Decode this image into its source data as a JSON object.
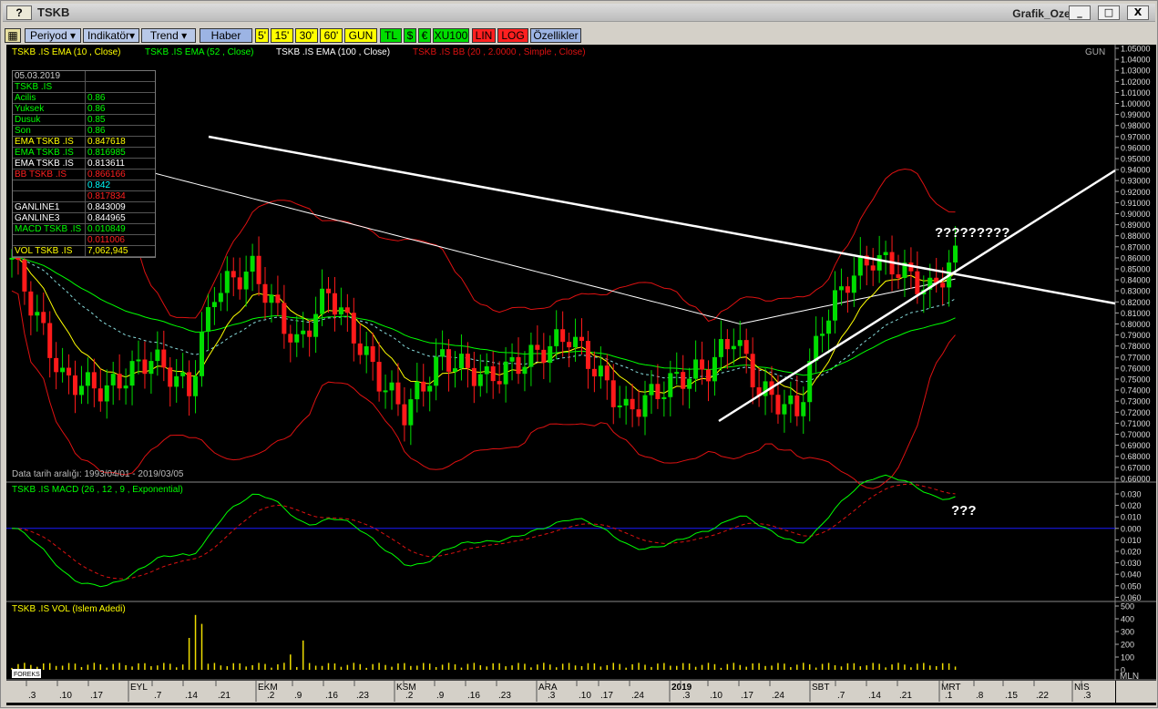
{
  "window": {
    "help_label": "?",
    "title": "TSKB",
    "right_title": "Grafik_Ozel",
    "minimize": "_",
    "maximize": "□",
    "close": "X"
  },
  "toolbar": {
    "period": "Periyod",
    "indicator": "Indikatör",
    "trend": "Trend",
    "news": "Haber",
    "intervals": [
      "5'",
      "15'",
      "30'",
      "60'",
      "GUN"
    ],
    "currency": [
      "TL",
      "$",
      "€",
      "XU100"
    ],
    "scale": [
      "LIN",
      "LOG"
    ],
    "properties": "Özellikler"
  },
  "legend": {
    "ema10": "TSKB .IS EMA (10 , Close)",
    "ema52": "TSKB .IS EMA (52 , Close)",
    "ema100": "TSKB .IS EMA (100 , Close)",
    "bb": "TSKB .IS BB (20 , 2.0000 , Simple , Close)",
    "period": "GUN",
    "date_range": "Data tarih aralığı: 1993/04/01 - 2019/03/05",
    "macd": "TSKB .IS MACD (26 , 12 , 9 , Exponential)",
    "vol": "TSKB .IS VOL (Islem Adedi)",
    "vol_unit": "MLN",
    "annotation_price": "?????????",
    "annotation_macd": "???"
  },
  "info_panel": {
    "date": "05.03.2019",
    "symbol": "TSKB .IS",
    "rows": [
      {
        "k": "Acilis",
        "v": "0.86",
        "c": "#00ff00"
      },
      {
        "k": "Yuksek",
        "v": "0.86",
        "c": "#00ff00"
      },
      {
        "k": "Dusuk",
        "v": "0.85",
        "c": "#00ff00"
      },
      {
        "k": "Son",
        "v": "0.86",
        "c": "#00ff00"
      },
      {
        "k": "EMA TSKB .IS",
        "v": "0.847618",
        "c": "#ffff00"
      },
      {
        "k": "EMA TSKB .IS",
        "v": "0.816985",
        "c": "#00ff00"
      },
      {
        "k": "EMA TSKB .IS",
        "v": "0.813611",
        "c": "#ffffff"
      },
      {
        "k": "BB TSKB .IS",
        "v": "0.866166",
        "c": "#ff2020"
      },
      {
        "k": "",
        "v": "0.842",
        "c": "#00ffff"
      },
      {
        "k": "",
        "v": "0.817834",
        "c": "#ff2020"
      },
      {
        "k": "GANLINE1",
        "v": "0.843009",
        "c": "#ffffff"
      },
      {
        "k": "GANLINE3",
        "v": "0.844965",
        "c": "#ffffff"
      },
      {
        "k": "MACD TSKB .IS",
        "v": "0.010849",
        "c": "#00ff00"
      },
      {
        "k": "",
        "v": "0.011006",
        "c": "#ff2020"
      },
      {
        "k": "VOL TSKB .IS",
        "v": "7,062,945",
        "c": "#ffff00"
      }
    ]
  },
  "price_axis": [
    "1.05000",
    "1.04000",
    "1.03000",
    "1.02000",
    "1.01000",
    "1.00000",
    "0.99000",
    "0.98000",
    "0.97000",
    "0.96000",
    "0.95000",
    "0.94000",
    "0.93000",
    "0.92000",
    "0.91000",
    "0.90000",
    "0.89000",
    "0.88000",
    "0.87000",
    "0.86000",
    "0.85000",
    "0.84000",
    "0.83000",
    "0.82000",
    "0.81000",
    "0.80000",
    "0.79000",
    "0.78000",
    "0.77000",
    "0.76000",
    "0.75000",
    "0.74000",
    "0.73000",
    "0.72000",
    "0.71000",
    "0.70000",
    "0.69000",
    "0.68000",
    "0.67000",
    "0.66000"
  ],
  "macd_axis": [
    "0.030",
    "0.020",
    "0.010",
    "0.000",
    "0.010",
    "0.020",
    "0.030",
    "0.040",
    "0.050",
    "0.060"
  ],
  "vol_axis": [
    "500",
    "400",
    "300",
    "200",
    "100",
    "0"
  ],
  "date_axis": [
    {
      "t": "3",
      "major": false
    },
    {
      "t": "10",
      "major": false
    },
    {
      "t": "17",
      "major": false
    },
    {
      "t": "EYL",
      "major": true
    },
    {
      "t": "7",
      "major": false
    },
    {
      "t": "14",
      "major": false
    },
    {
      "t": "21",
      "major": false
    },
    {
      "t": "EKM",
      "major": true
    },
    {
      "t": "2",
      "major": false
    },
    {
      "t": "9",
      "major": false
    },
    {
      "t": "16",
      "major": false
    },
    {
      "t": "23",
      "major": false
    },
    {
      "t": "KSM",
      "major": true
    },
    {
      "t": "2",
      "major": false
    },
    {
      "t": "9",
      "major": false
    },
    {
      "t": "16",
      "major": false
    },
    {
      "t": "23",
      "major": false
    },
    {
      "t": "ARA",
      "major": true
    },
    {
      "t": "3",
      "major": false
    },
    {
      "t": "10",
      "major": false
    },
    {
      "t": "17",
      "major": false
    },
    {
      "t": "24",
      "major": false
    },
    {
      "t": "2019",
      "major": true
    },
    {
      "t": "3",
      "major": false
    },
    {
      "t": "10",
      "major": false
    },
    {
      "t": "17",
      "major": false
    },
    {
      "t": "24",
      "major": false
    },
    {
      "t": "SBT",
      "major": true
    },
    {
      "t": "7",
      "major": false
    },
    {
      "t": "14",
      "major": false
    },
    {
      "t": "21",
      "major": false
    },
    {
      "t": "MRT",
      "major": true
    },
    {
      "t": "1",
      "major": false
    },
    {
      "t": "8",
      "major": false
    },
    {
      "t": "15",
      "major": false
    },
    {
      "t": "22",
      "major": false
    },
    {
      "t": "NIS",
      "major": true
    },
    {
      "t": "3",
      "major": false
    }
  ],
  "colors": {
    "up": "#00dd00",
    "down": "#ff1a1a",
    "ema10": "#ffff00",
    "ema52": "#00ff00",
    "ema100": "#ffffff",
    "bb": "#dd1111",
    "zero": "#1a1aff"
  }
}
